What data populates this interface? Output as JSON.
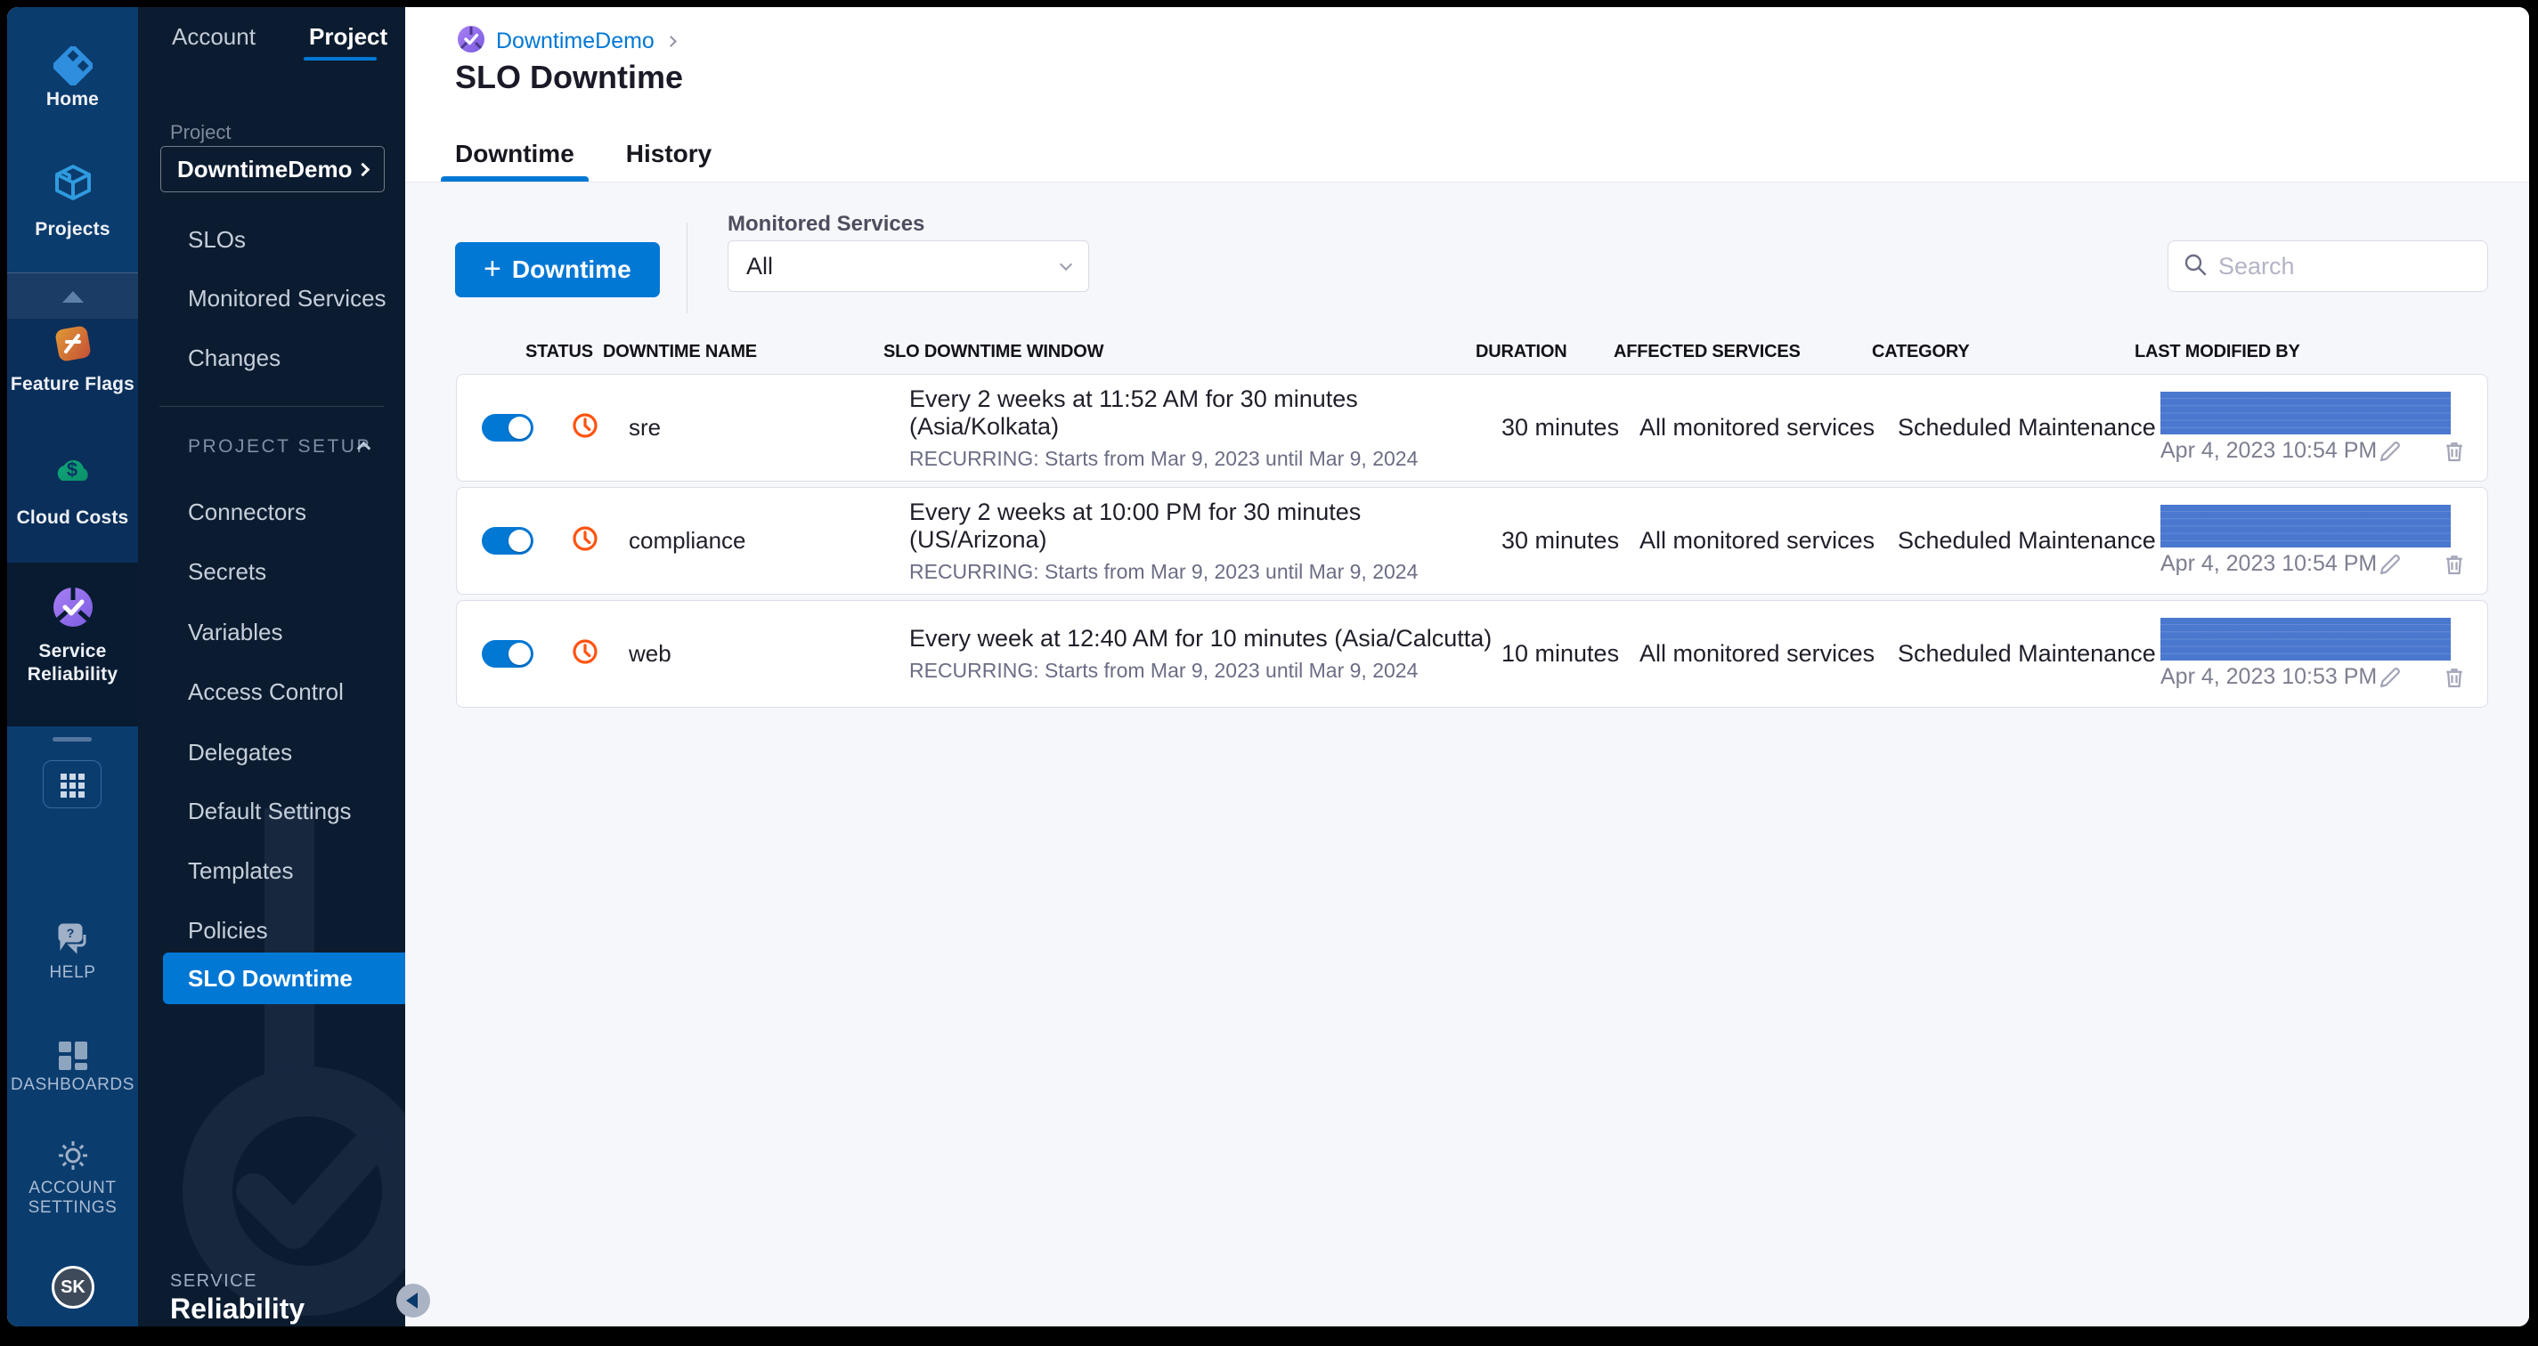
{
  "colors": {
    "primary": "#0278d5",
    "clock_icon": "#ff5310",
    "redacted_pixels": "#4a78cf"
  },
  "icons": {
    "plus": "+",
    "avatar_initials": "SK"
  },
  "sidebar": {
    "home": "Home",
    "projects": "Projects",
    "feature_flags": "Feature Flags",
    "cloud_costs": "Cloud Costs",
    "service_reliability_line1": "Service",
    "service_reliability_line2": "Reliability",
    "help": "HELP",
    "dashboards": "DASHBOARDS",
    "account_settings_line1": "ACCOUNT",
    "account_settings_line2": "SETTINGS",
    "avatar": "SK"
  },
  "nav": {
    "tab_account": "Account",
    "tab_project": "Project",
    "project_label": "Project",
    "project_name": "DowntimeDemo",
    "items": [
      "SLOs",
      "Monitored Services",
      "Changes"
    ],
    "section_title": "PROJECT SETUP",
    "setup_items": [
      "Connectors",
      "Secrets",
      "Variables",
      "Access Control",
      "Delegates",
      "Default Settings",
      "Templates",
      "Policies"
    ],
    "active_item": "SLO Downtime",
    "footer_top": "SERVICE",
    "footer_bottom": "Reliability"
  },
  "header": {
    "breadcrumb": "DowntimeDemo",
    "title": "SLO Downtime",
    "tab_downtime": "Downtime",
    "tab_history": "History"
  },
  "toolbar": {
    "plus": "+",
    "new_button_label": "Downtime",
    "monitored_services_label": "Monitored Services",
    "monitored_services_value": "All",
    "search_placeholder": "Search"
  },
  "table": {
    "columns": [
      "STATUS",
      "DOWNTIME NAME",
      "SLO DOWNTIME WINDOW",
      "DURATION",
      "AFFECTED SERVICES",
      "CATEGORY",
      "LAST MODIFIED BY"
    ],
    "rows": [
      {
        "enabled": true,
        "name": "sre",
        "window": "Every 2 weeks at 11:52 AM for 30 minutes (Asia/Kolkata)",
        "recurrence": "RECURRING: Starts from Mar 9, 2023 until Mar 9, 2024",
        "duration": "30 minutes",
        "affected_services": "All monitored services",
        "category": "Scheduled Maintenance",
        "last_modified": "Apr 4, 2023 10:54 PM"
      },
      {
        "enabled": true,
        "name": "compliance",
        "window": "Every 2 weeks at 10:00 PM for 30 minutes (US/Arizona)",
        "recurrence": "RECURRING: Starts from Mar 9, 2023 until Mar 9, 2024",
        "duration": "30 minutes",
        "affected_services": "All monitored services",
        "category": "Scheduled Maintenance",
        "last_modified": "Apr 4, 2023 10:54 PM"
      },
      {
        "enabled": true,
        "name": "web",
        "window": "Every week at 12:40 AM for 10 minutes (Asia/Calcutta)",
        "recurrence": "RECURRING: Starts from Mar 9, 2023 until Mar 9, 2024",
        "duration": "10 minutes",
        "affected_services": "All monitored services",
        "category": "Scheduled Maintenance",
        "last_modified": "Apr 4, 2023 10:53 PM"
      }
    ]
  }
}
